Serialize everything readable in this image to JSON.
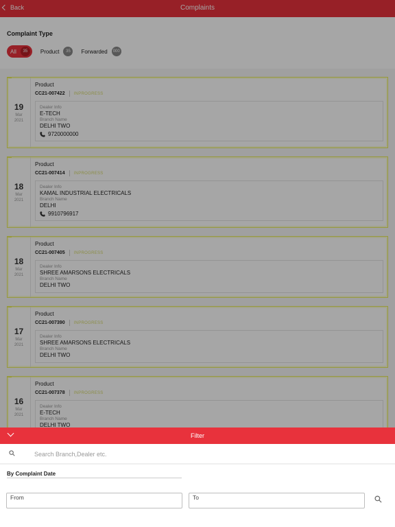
{
  "header": {
    "back_label": "Back",
    "title": "Complaints"
  },
  "complaint_type": {
    "title": "Complaint Type",
    "chips": [
      {
        "label": "All",
        "count": "35",
        "active": true
      },
      {
        "label": "Product",
        "count": "35",
        "active": false
      },
      {
        "label": "Forwarded",
        "count": "000",
        "active": false
      }
    ]
  },
  "complaints": [
    {
      "day": "19",
      "month": "Mar",
      "year": "2021",
      "category": "Product",
      "ref": "CC21-007422",
      "status": "INPROGRESS",
      "dealer_label": "Dealer Info",
      "dealer": "E-TECH",
      "branch_label": "Branch Name",
      "branch": "DELHI TWO",
      "phone": "9720000000"
    },
    {
      "day": "18",
      "month": "Mar",
      "year": "2021",
      "category": "Product",
      "ref": "CC21-007414",
      "status": "INPROGRESS",
      "dealer_label": "Dealer Info",
      "dealer": "KAMAL INDUSTRIAL ELECTRICALS",
      "branch_label": "Branch Name",
      "branch": "DELHI",
      "phone": "9910796917"
    },
    {
      "day": "18",
      "month": "Mar",
      "year": "2021",
      "category": "Product",
      "ref": "CC21-007405",
      "status": "INPROGRESS",
      "dealer_label": "Dealer Info",
      "dealer": "SHREE AMARSONS ELECTRICALS",
      "branch_label": "Branch Name",
      "branch": "DELHI TWO"
    },
    {
      "day": "17",
      "month": "Mar",
      "year": "2021",
      "category": "Product",
      "ref": "CC21-007390",
      "status": "INPROGRESS",
      "dealer_label": "Dealer Info",
      "dealer": "SHREE AMARSONS ELECTRICALS",
      "branch_label": "Branch Name",
      "branch": "DELHI TWO"
    },
    {
      "day": "16",
      "month": "Mar",
      "year": "2021",
      "category": "Product",
      "ref": "CC21-007378",
      "status": "INPROGRESS",
      "dealer_label": "Dealer Info",
      "dealer": "E-TECH",
      "branch_label": "Branch Name",
      "branch": "DELHI TWO"
    }
  ],
  "filter": {
    "title": "Filter",
    "search_placeholder": "Search Branch,Dealer etc.",
    "date_label": "By Complaint Date",
    "from_placeholder": "From",
    "to_placeholder": "To"
  },
  "colors": {
    "accent": "#e8323c",
    "card_border": "#e9ec5a"
  }
}
